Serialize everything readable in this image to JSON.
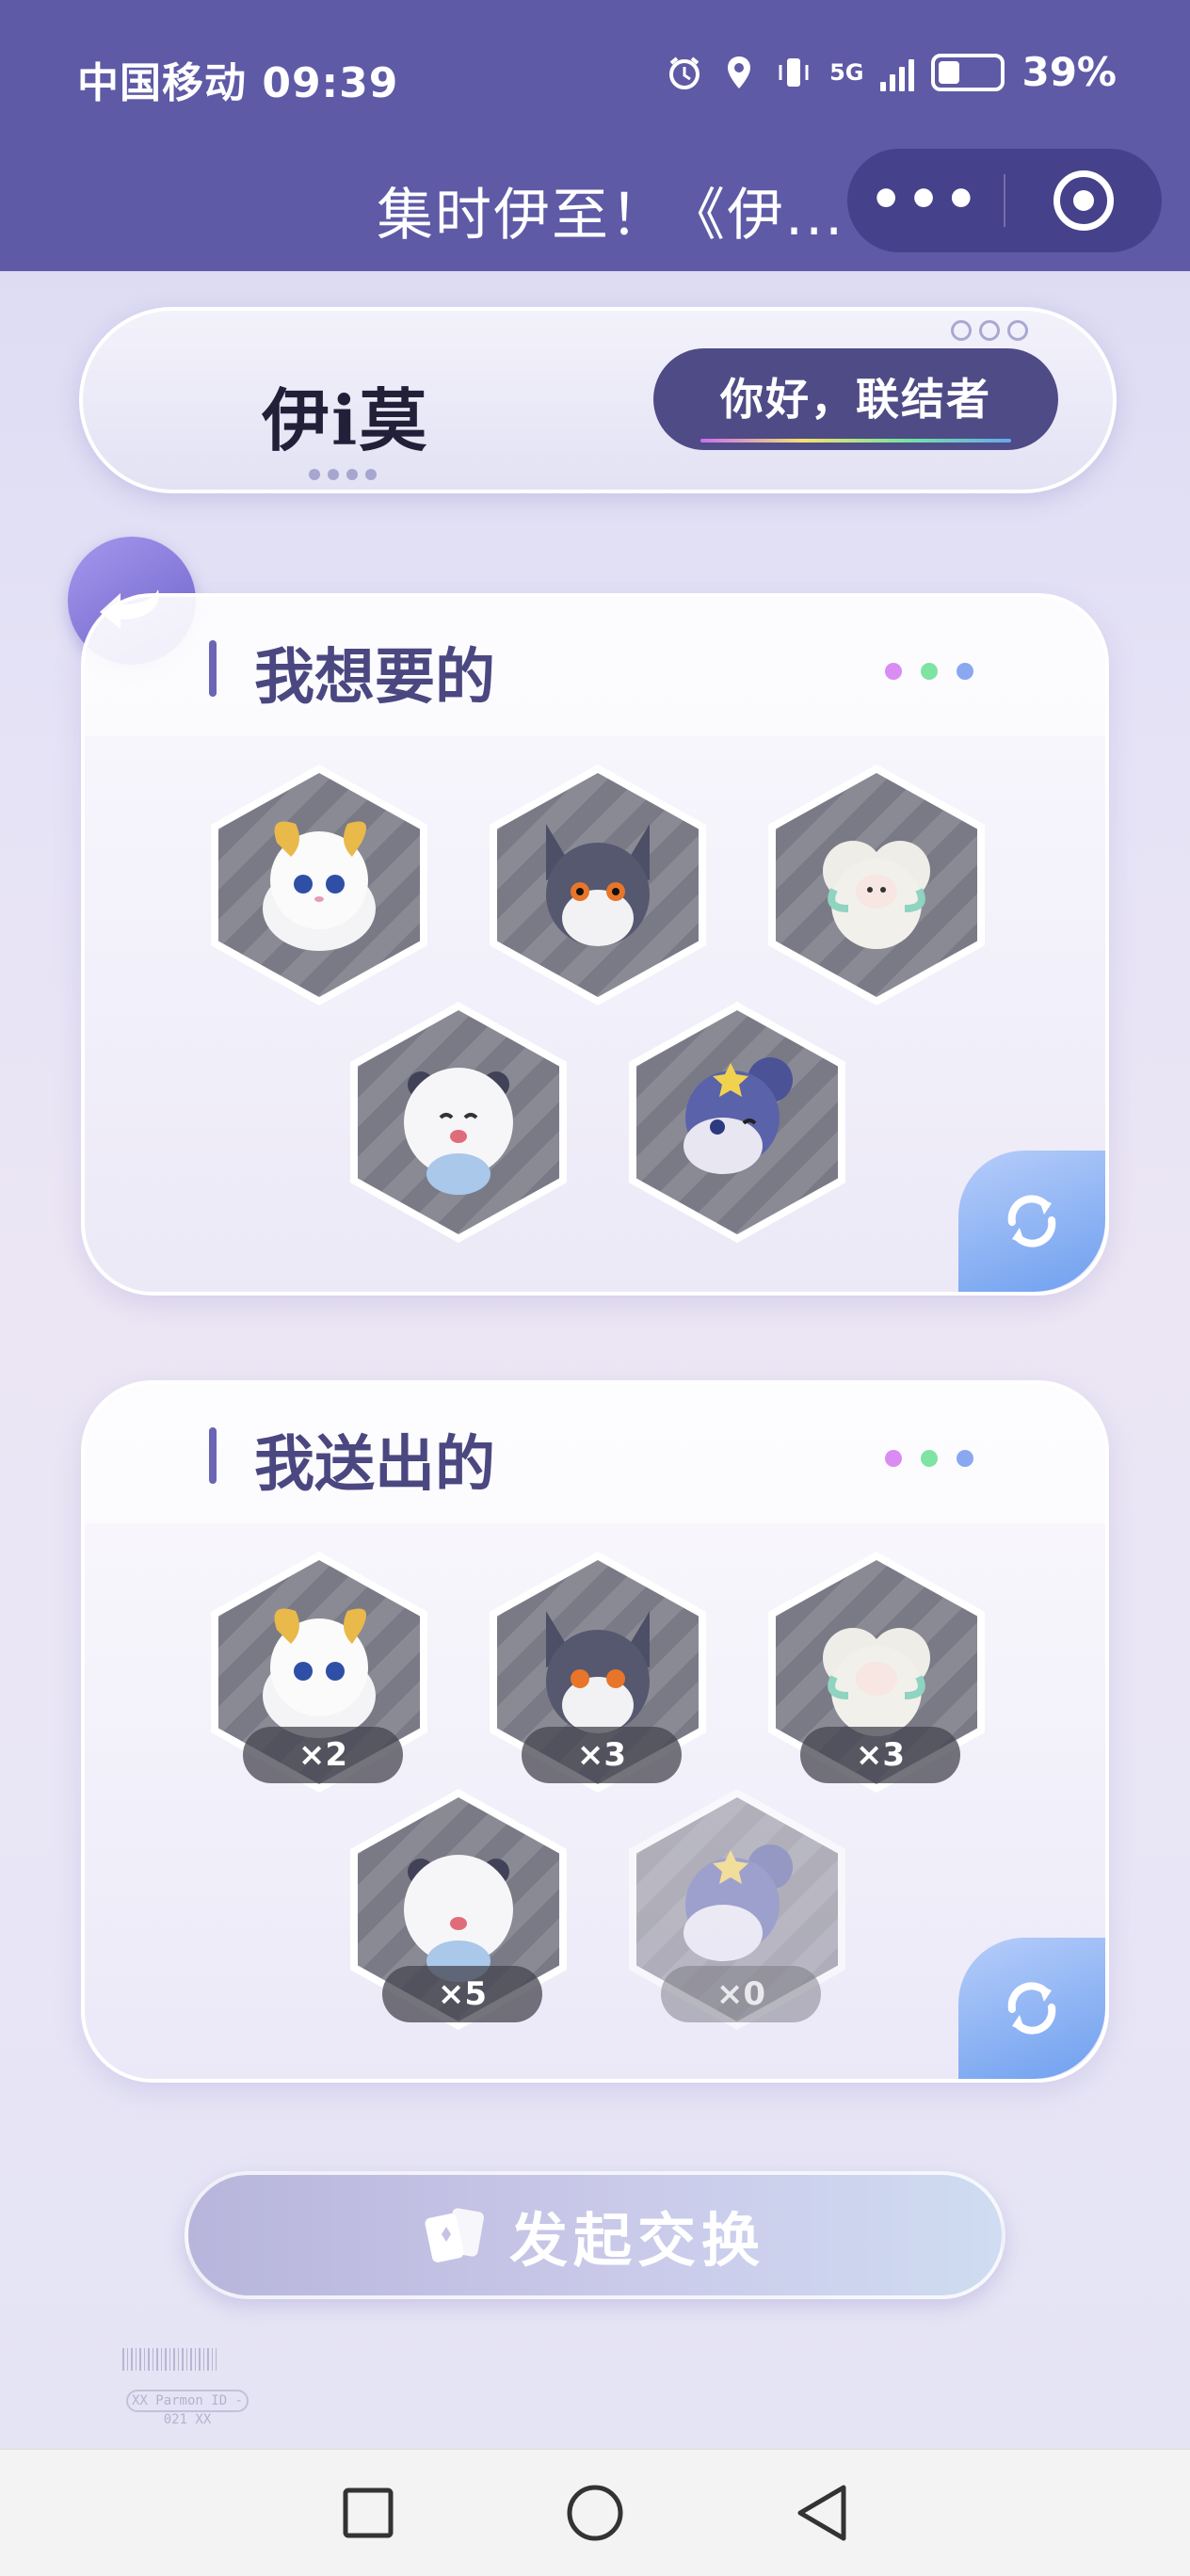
{
  "status_bar": {
    "carrier": "中国移动",
    "time": "09:39",
    "network": "5G",
    "battery": "39%"
  },
  "header": {
    "title": "集时伊至！《伊...",
    "more_label": "•••"
  },
  "brand": {
    "logo": "伊i莫",
    "greeting": "你好，联结者"
  },
  "want_card": {
    "title": "我想要的",
    "dots": [
      "#d98cf2",
      "#7fe3a3",
      "#8aa8f0"
    ],
    "pets": [
      {
        "name": "golden-fluffy-pet",
        "color": "#f1e6c5"
      },
      {
        "name": "gray-fox-pet",
        "color": "#4c4f63"
      },
      {
        "name": "cloud-sheep-pet",
        "color": "#e6e4dc"
      },
      {
        "name": "white-seal-pet",
        "color": "#f1f1f3"
      },
      {
        "name": "blue-star-mouse-pet",
        "color": "#5b63a8"
      }
    ]
  },
  "give_card": {
    "title": "我送出的",
    "dots": [
      "#d98cf2",
      "#7fe3a3",
      "#8aa8f0"
    ],
    "pets": [
      {
        "name": "golden-fluffy-pet",
        "count": "×2"
      },
      {
        "name": "gray-fox-pet",
        "count": "×3"
      },
      {
        "name": "cloud-sheep-pet",
        "count": "×3"
      },
      {
        "name": "white-seal-pet",
        "count": "×5"
      },
      {
        "name": "blue-star-mouse-pet",
        "count": "×0"
      }
    ]
  },
  "exchange_button": {
    "label": "发起交换"
  },
  "footer": {
    "tag": "XX  Parmon ID - 021  XX"
  }
}
